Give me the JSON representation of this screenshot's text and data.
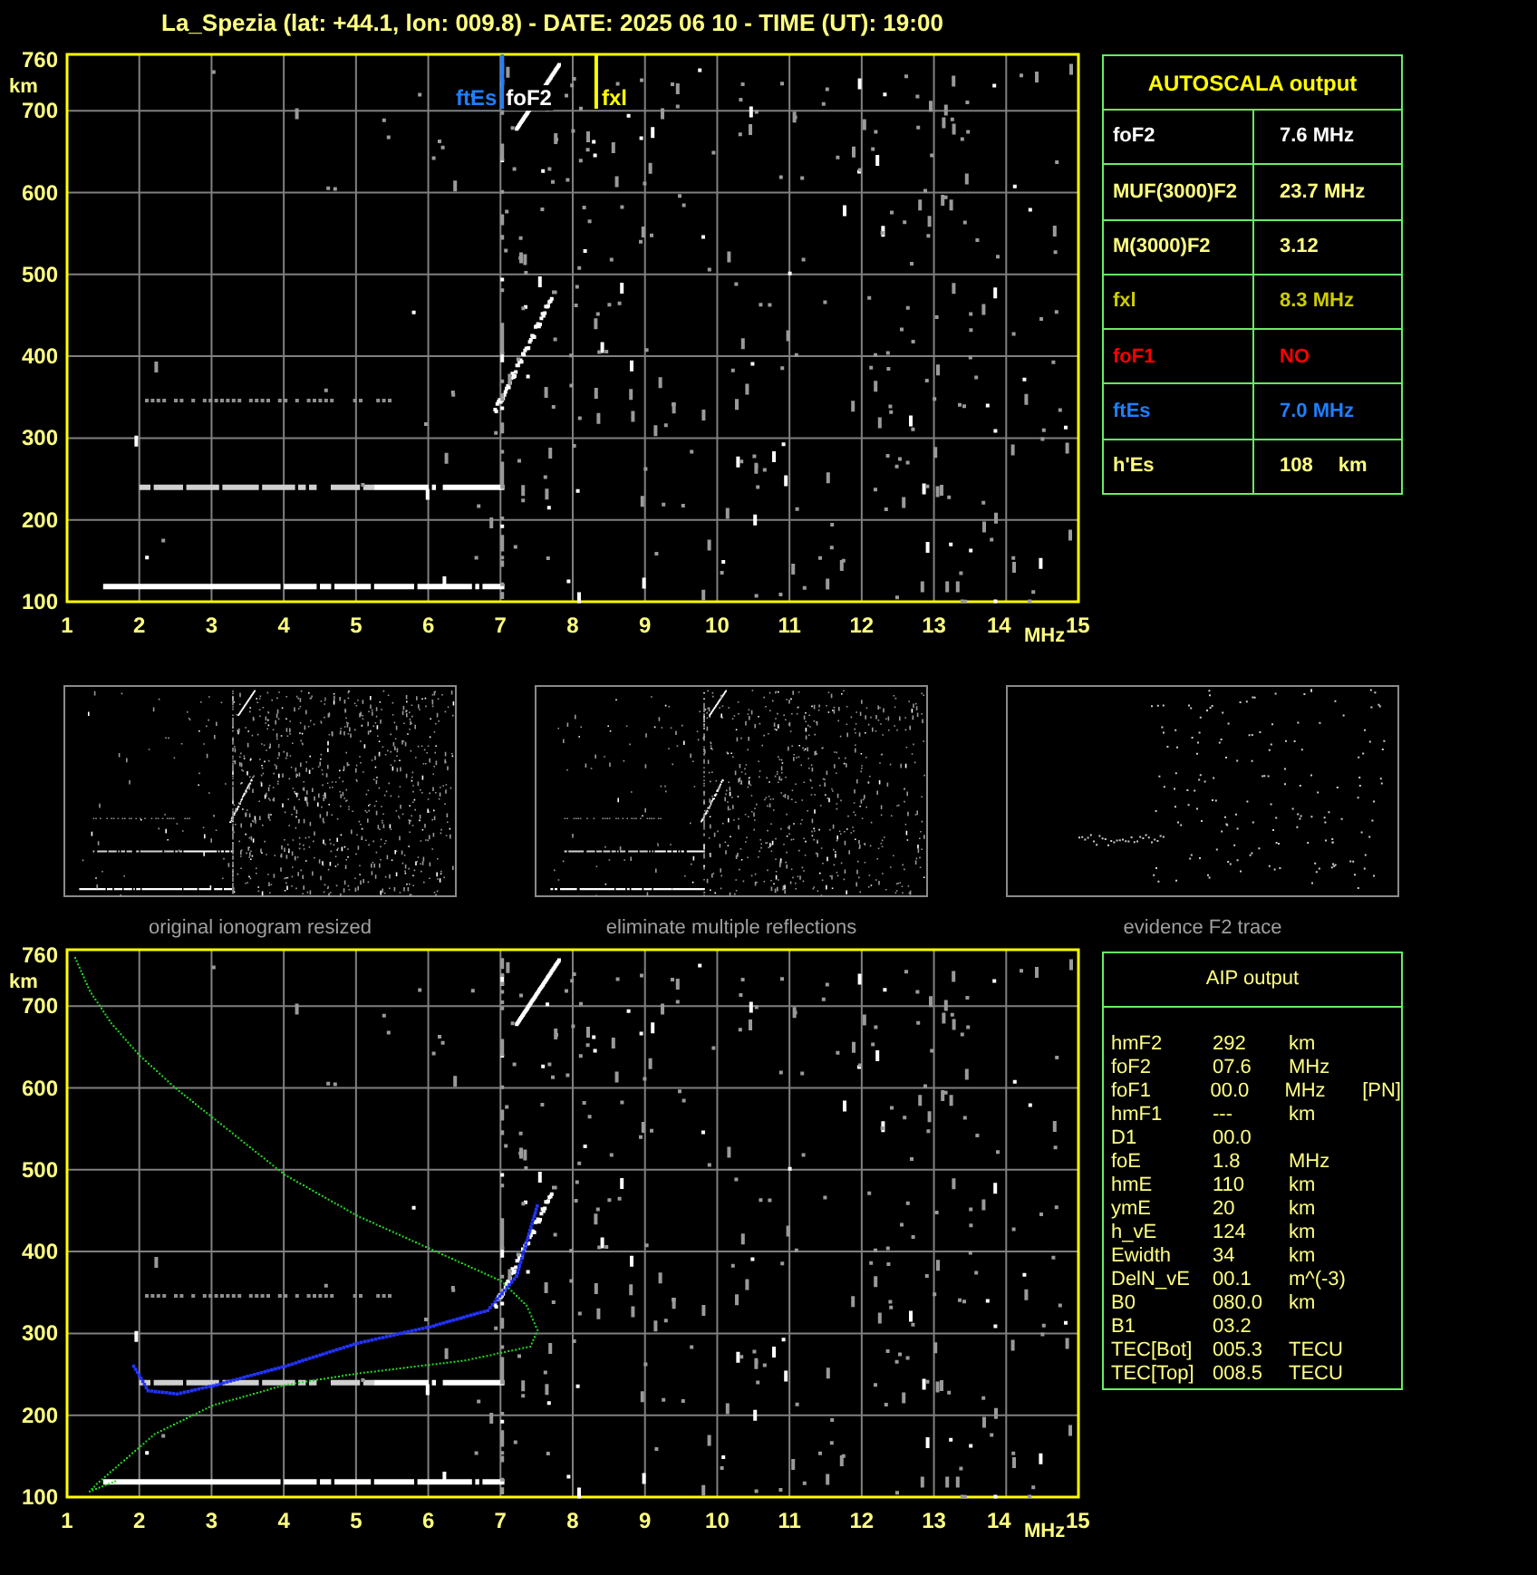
{
  "title": "La_Spezia (lat: +44.1, lon: 009.8) - DATE: 2025 06 10 - TIME (UT): 19:00",
  "ionogram": {
    "y_ticks": [
      "760",
      "700",
      "600",
      "500",
      "400",
      "300",
      "200",
      "100"
    ],
    "y_unit": "km",
    "x_ticks": [
      "1",
      "2",
      "3",
      "4",
      "5",
      "6",
      "7",
      "8",
      "9",
      "10",
      "11",
      "12",
      "13",
      "14"
    ],
    "x_unit": "MHz",
    "x_end": "15",
    "markers": [
      {
        "label": "ftEs",
        "color": "#1e7fff"
      },
      {
        "label": "foF2",
        "color": "#ffffff"
      },
      {
        "label": "fxl",
        "color": "#ffff00"
      }
    ]
  },
  "autoscala": {
    "title": "AUTOSCALA output",
    "rows": [
      {
        "label": "foF2",
        "value": "7.6 MHz",
        "color": "#ffffff"
      },
      {
        "label": "MUF(3000)F2",
        "value": "23.7 MHz",
        "color": "#ffff80"
      },
      {
        "label": "M(3000)F2",
        "value": "3.12",
        "color": "#ffff80"
      },
      {
        "label": "fxl",
        "value": "8.3 MHz",
        "color": "#cccc00"
      },
      {
        "label": "foF1",
        "value": "NO",
        "color": "#ff0000"
      },
      {
        "label": "ftEs",
        "value": "7.0 MHz",
        "color": "#1e7fff"
      },
      {
        "label": "h'Es",
        "value": "108",
        "unit": "km",
        "color": "#ffff80"
      }
    ]
  },
  "thumbnails": [
    {
      "caption": "original ionogram resized"
    },
    {
      "caption": "eliminate multiple reflections"
    },
    {
      "caption": "evidence F2 trace"
    }
  ],
  "profile_chart": {
    "y_ticks": [
      "760",
      "700",
      "600",
      "500",
      "400",
      "300",
      "200",
      "100"
    ],
    "y_unit": "km",
    "x_ticks": [
      "1",
      "2",
      "3",
      "4",
      "5",
      "6",
      "7",
      "8",
      "9",
      "10",
      "11",
      "12",
      "13",
      "14"
    ],
    "x_unit": "MHz",
    "x_end": "15"
  },
  "aip": {
    "title": "AIP output",
    "rows": [
      {
        "name": "hmF2",
        "value": "292",
        "unit": "km"
      },
      {
        "name": "foF2",
        "value": "07.6",
        "unit": "MHz"
      },
      {
        "name": "foF1",
        "value": "00.0",
        "unit": "MHz",
        "note": "[PN]"
      },
      {
        "name": "hmF1",
        "value": "---",
        "unit": "km"
      },
      {
        "name": "D1",
        "value": "00.0"
      },
      {
        "name": "foE",
        "value": "1.8",
        "unit": "MHz"
      },
      {
        "name": "hmE",
        "value": "110",
        "unit": "km"
      },
      {
        "name": "ymE",
        "value": "20",
        "unit": "km"
      },
      {
        "name": "h_vE",
        "value": "124",
        "unit": "km"
      },
      {
        "name": "Ewidth",
        "value": "34",
        "unit": "km"
      },
      {
        "name": "DelN_vE",
        "value": "00.1",
        "unit": "m^(-3)"
      },
      {
        "name": "B0",
        "value": "080.0",
        "unit": "km"
      },
      {
        "name": "B1",
        "value": "03.2"
      },
      {
        "name": "TEC[Bot]",
        "value": "005.3",
        "unit": "TECU"
      },
      {
        "name": "TEC[Top]",
        "value": "008.5",
        "unit": "TECU"
      }
    ]
  }
}
